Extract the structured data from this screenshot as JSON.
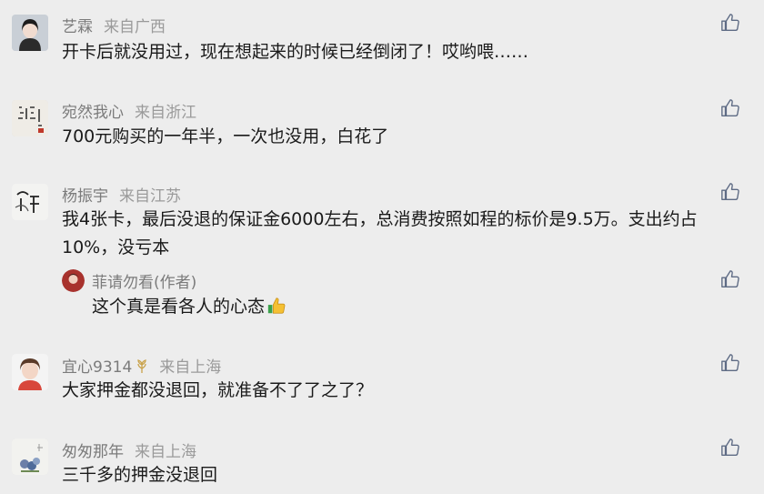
{
  "comments": [
    {
      "name": "艺霖",
      "location": "来自广西",
      "text": "开卡后就没用过，现在想起来的时候已经倒闭了！哎哟喂……"
    },
    {
      "name": "宛然我心",
      "location": "来自浙江",
      "text": "700元购买的一年半，一次也没用，白花了"
    },
    {
      "name": "杨振宇",
      "location": "来自江苏",
      "text": "我4张卡，最后没退的保证金6000左右，总消费按照如程的标价是9.5万。支出约占10%，没亏本",
      "reply": {
        "name": "菲请勿看(作者)",
        "text": "这个真是看各人的心态"
      }
    },
    {
      "name": "宜心9314",
      "location": "来自上海",
      "text": "大家押金都没退回，就准备不了了之了？"
    },
    {
      "name": "匆匆那年",
      "location": "来自上海",
      "text": "三千多的押金没退回"
    }
  ],
  "icons": {
    "like": "thumbs-up-icon",
    "reply_emoji": "thumbs-up-emoji-icon",
    "badge": "wheat-badge-icon"
  },
  "colors": {
    "background": "#ededed",
    "name": "#7b7b7b",
    "text": "#1a1a1a",
    "like": "#5e6b84"
  }
}
